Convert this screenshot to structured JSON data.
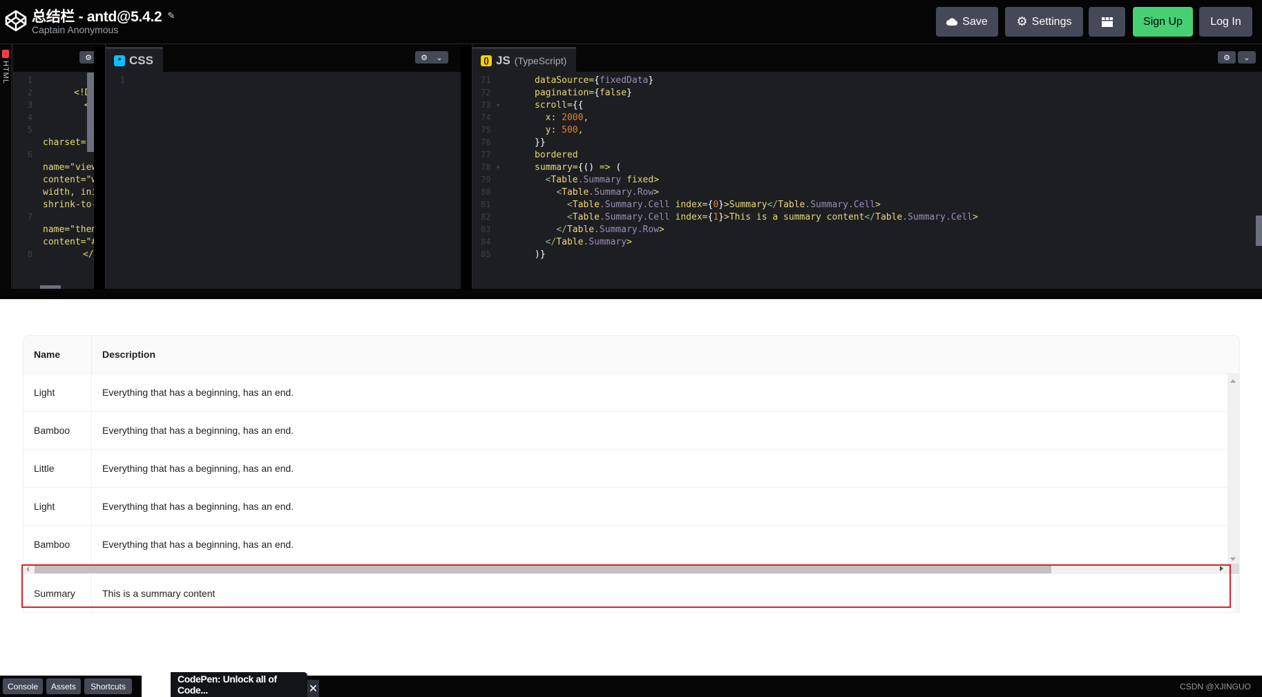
{
  "header": {
    "title": "总结栏 - antd@5.4.2",
    "author": "Captain Anonymous",
    "buttons": {
      "save": "Save",
      "settings": "Settings",
      "signup": "Sign Up",
      "login": "Log In"
    }
  },
  "editors": {
    "html": {
      "label": "HTML",
      "lines": [
        {
          "num": "1",
          "text": ""
        },
        {
          "num": "2",
          "text": "<!DOC"
        },
        {
          "num": "3",
          "text": "<ht"
        },
        {
          "num": "4",
          "text": "<"
        },
        {
          "num": "5",
          "text": ""
        },
        {
          "num": "",
          "text": "charset=\"u"
        },
        {
          "num": "6",
          "text": ""
        },
        {
          "num": "",
          "text": "name=\"view"
        },
        {
          "num": "",
          "text": "content=\"w"
        },
        {
          "num": "",
          "text": "width, ini"
        },
        {
          "num": "",
          "text": "shrink-to-"
        },
        {
          "num": "7",
          "text": ""
        },
        {
          "num": "",
          "text": "name=\"them"
        },
        {
          "num": "",
          "text": "content=\"#"
        },
        {
          "num": "8",
          "text": "</"
        }
      ]
    },
    "css": {
      "label": "CSS",
      "lines": [
        {
          "num": "1",
          "text": ""
        }
      ]
    },
    "js": {
      "label": "JS",
      "sublabel": "(TypeScript)",
      "line_numbers": [
        "71",
        "72",
        "73",
        "74",
        "75",
        "76",
        "77",
        "78",
        "79",
        "80",
        "81",
        "82",
        "83",
        "84",
        "85"
      ],
      "lines": [
        "dataSource={fixedData}",
        "pagination={false}",
        "scroll={{",
        "  x: 2000,",
        "  y: 500,",
        "}}",
        "bordered",
        "summary={() => (",
        "  <Table.Summary fixed>",
        "    <Table.Summary.Row>",
        "      <Table.Summary.Cell index={0}>Summary</Table.Summary.Cell>",
        "      <Table.Summary.Cell index={1}>This is a summary content</Table.Summary.Cell>",
        "    </Table.Summary.Row>",
        "  </Table.Summary>",
        ")}"
      ]
    }
  },
  "table": {
    "columns": [
      "Name",
      "Description"
    ],
    "rows": [
      {
        "name": "Light",
        "description": "Everything that has a beginning, has an end."
      },
      {
        "name": "Bamboo",
        "description": "Everything that has a beginning, has an end."
      },
      {
        "name": "Little",
        "description": "Everything that has a beginning, has an end."
      },
      {
        "name": "Light",
        "description": "Everything that has a beginning, has an end."
      },
      {
        "name": "Bamboo",
        "description": "Everything that has a beginning, has an end."
      }
    ],
    "summary": {
      "name": "Summary",
      "description": "This is a summary content"
    },
    "horizontal_scroll_visible_fraction": 0.86,
    "highlight_color": "#e0202b"
  },
  "bottombar": {
    "console": "Console",
    "assets": "Assets",
    "shortcuts": "Shortcuts",
    "promo": "CodePen: Unlock all of Code...",
    "close": "✕",
    "watermark": "CSDN @XJINGUO"
  },
  "colors": {
    "accent_green": "#47cf73",
    "button_gray": "#444857",
    "editor_bg": "#1d1e22",
    "css_icon": "#0ebeff",
    "js_icon": "#fcd000",
    "html_icon": "#ff3c41"
  }
}
